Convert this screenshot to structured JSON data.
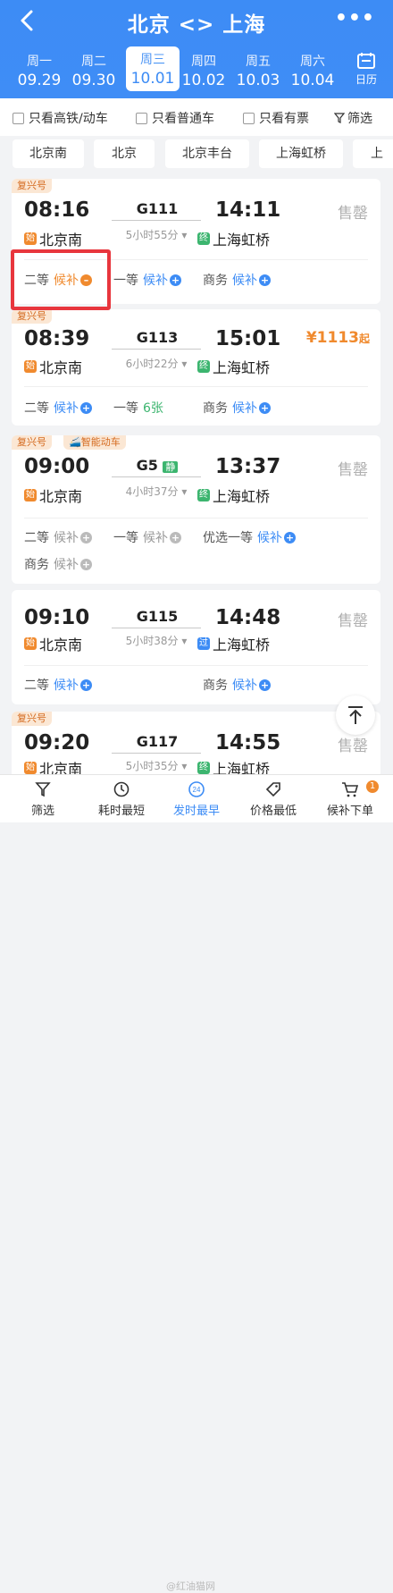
{
  "header": {
    "title": "北京 <> 上海",
    "more": "•••",
    "calendar_label": "日历"
  },
  "dates": [
    {
      "weekday": "周一",
      "date": "09.29"
    },
    {
      "weekday": "周二",
      "date": "09.30"
    },
    {
      "weekday": "周三",
      "date": "10.01",
      "selected": true
    },
    {
      "weekday": "周四",
      "date": "10.02"
    },
    {
      "weekday": "周五",
      "date": "10.03"
    },
    {
      "weekday": "周六",
      "date": "10.04"
    }
  ],
  "filters": {
    "gaotie": "只看高铁/动车",
    "putong": "只看普通车",
    "youpiao": "只看有票",
    "screen": "筛选"
  },
  "stations": [
    "北京南",
    "北京",
    "北京丰台",
    "上海虹桥",
    "上"
  ],
  "trains": [
    {
      "tag": "复兴号",
      "dep": "08:16",
      "train": "G111",
      "arr": "14:11",
      "duration": "5小时55分",
      "from_icon": "始",
      "from": "北京南",
      "to_icon": "终",
      "to": "上海虹桥",
      "status": "售罄",
      "seats": [
        {
          "name": "二等",
          "value": "候补"
        },
        {
          "name": "一等",
          "value": "候补"
        },
        {
          "name": "商务",
          "value": "候补"
        }
      ]
    },
    {
      "tag": "复兴号",
      "dep": "08:39",
      "train": "G113",
      "arr": "15:01",
      "duration": "6小时22分",
      "from_icon": "始",
      "from": "北京南",
      "to_icon": "终",
      "to": "上海虹桥",
      "price": "¥1113",
      "price_suffix": "起",
      "seats": [
        {
          "name": "二等",
          "value": "候补"
        },
        {
          "name": "一等",
          "value": "6张"
        },
        {
          "name": "商务",
          "value": "候补"
        }
      ]
    },
    {
      "tag": "复兴号",
      "tag2": "智能动车",
      "dep": "09:00",
      "train": "G5",
      "train_badge": "静",
      "arr": "13:37",
      "duration": "4小时37分",
      "from_icon": "始",
      "from": "北京南",
      "to_icon": "终",
      "to": "上海虹桥",
      "status": "售罄",
      "seats": [
        {
          "name": "二等",
          "value": "候补"
        },
        {
          "name": "一等",
          "value": "候补"
        },
        {
          "name": "优选一等",
          "value": "候补"
        },
        {
          "name": "商务",
          "value": "候补"
        }
      ]
    },
    {
      "dep": "09:10",
      "train": "G115",
      "arr": "14:48",
      "duration": "5小时38分",
      "from_icon": "始",
      "from": "北京南",
      "to_icon": "过",
      "to": "上海虹桥",
      "status": "售罄",
      "seats": [
        {
          "name": "二等",
          "value": "候补"
        },
        {
          "name": "商务",
          "value": "候补"
        }
      ]
    },
    {
      "tag": "复兴号",
      "dep": "09:20",
      "train": "G117",
      "arr": "14:55",
      "duration": "5小时35分",
      "from_icon": "始",
      "from": "北京南",
      "to_icon": "终",
      "to": "上海虹桥",
      "status": "售罄"
    }
  ],
  "bottom": {
    "filter": "筛选",
    "shortest": "耗时最短",
    "earliest": "发时最早",
    "earliest_icon": "24",
    "cheapest": "价格最低",
    "waitlist": "候补下单",
    "waitlist_badge": "1"
  },
  "watermark": "@红油猫网",
  "colors": {
    "primary": "#3d8cf5",
    "orange": "#f08a2e",
    "green": "#3cb56f",
    "highlight": "#e8363d"
  }
}
